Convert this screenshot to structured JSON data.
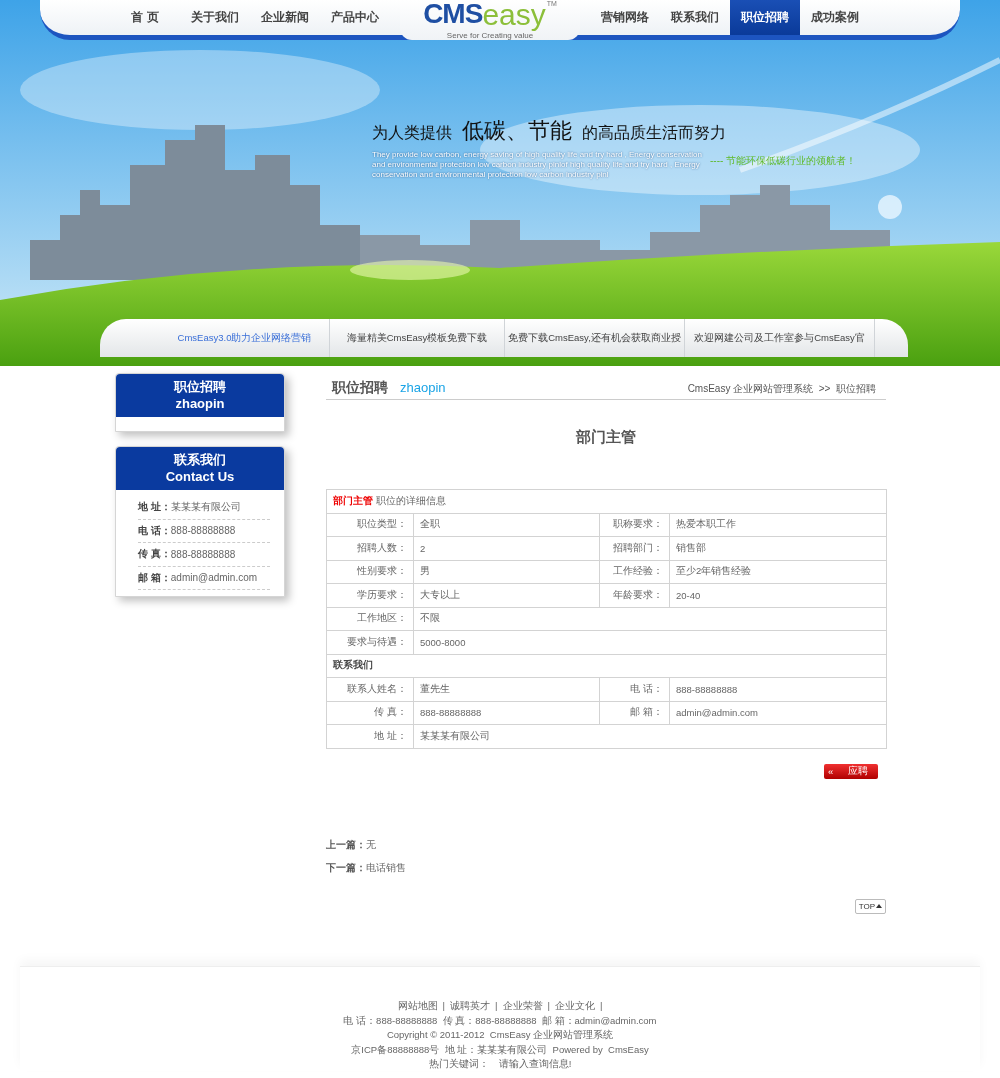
{
  "nav": {
    "left": [
      {
        "label": "首 页",
        "selected": false
      },
      {
        "label": "关于我们",
        "selected": false
      },
      {
        "label": "企业新闻",
        "selected": false
      },
      {
        "label": "产品中心",
        "selected": false
      }
    ],
    "right": [
      {
        "label": "营销网络",
        "selected": false
      },
      {
        "label": "联系我们",
        "selected": false
      },
      {
        "label": "职位招聘",
        "selected": true
      },
      {
        "label": "成功案例",
        "selected": false
      }
    ]
  },
  "logo": {
    "main": "CMS",
    "accent": "easy",
    "trademark": "TM",
    "tagline": "Serve for Creating value"
  },
  "banner": {
    "slogan_start": "为人类提供",
    "slogan_big": "低碳、节能",
    "slogan_end": "的高品质生活而努力",
    "english": "They provide low carbon, energy saving of high quality life and try hard , Energy conservation and environmental protection low carbon industry pinlof high quality life and try hard , Energy conservation and environmental protection low carbon industry pinl",
    "subline": "----  节能环保低碳行业的领航者！"
  },
  "news_tabs": [
    {
      "label": "CmsEasy3.0助力企业网络营销",
      "selected": true
    },
    {
      "label": "海量精美CmsEasy模板免费下载",
      "selected": false
    },
    {
      "label": "免费下载CmsEasy,还有机会获取商业授",
      "selected": false
    },
    {
      "label": "欢迎网建公司及工作室参与CmsEasy官",
      "selected": false
    }
  ],
  "sidebar": {
    "category": {
      "title": "职位招聘",
      "subtitle": "zhaopin"
    },
    "contact": {
      "title": "联系我们",
      "subtitle": "Contact Us",
      "items": [
        {
          "label": "地 址：",
          "value": "某某某有限公司"
        },
        {
          "label": "电 话：",
          "value": "888-88888888"
        },
        {
          "label": "传 真：",
          "value": "888-88888888"
        },
        {
          "label": "邮 箱：",
          "value": "admin@admin.com"
        }
      ]
    }
  },
  "main": {
    "heading": "职位招聘",
    "heading_en": "zhaopin",
    "breadcrumb": "CmsEasy 企业网站管理系统  >>  职位招聘",
    "job_title": "部门主管",
    "table": {
      "caption_highlight": "部门主管",
      "caption": "职位的详细信息",
      "rows": [
        [
          {
            "label": "职位类型：",
            "value": "全职"
          },
          {
            "label": "职称要求：",
            "value": "热爱本职工作"
          }
        ],
        [
          {
            "label": "招聘人数：",
            "value": "2"
          },
          {
            "label": "招聘部门：",
            "value": "销售部"
          }
        ],
        [
          {
            "label": "性别要求：",
            "value": "男"
          },
          {
            "label": "工作经验：",
            "value": "至少2年销售经验"
          }
        ],
        [
          {
            "label": "学历要求：",
            "value": "大专以上"
          },
          {
            "label": "年龄要求：",
            "value": "20-40"
          }
        ],
        [
          {
            "label": "工作地区：",
            "value": "不限"
          }
        ],
        [
          {
            "label": "要求与待遇：",
            "value": "5000-8000"
          }
        ]
      ],
      "contact_heading": "联系我们",
      "contact_rows": [
        [
          {
            "label": "联系人姓名：",
            "value": "董先生"
          },
          {
            "label": "电 话：",
            "value": "888-88888888"
          }
        ],
        [
          {
            "label": "传 真：",
            "value": "888-88888888"
          },
          {
            "label": "邮 箱：",
            "value": "admin@admin.com"
          }
        ],
        [
          {
            "label": "地 址：",
            "value": "某某某有限公司"
          }
        ]
      ]
    },
    "apply_button": {
      "arrow": "«",
      "label": "应聘"
    },
    "prev": {
      "label": "上一篇：",
      "value": "无"
    },
    "next": {
      "label": "下一篇：",
      "value": "电话销售"
    },
    "top_button": "TOP"
  },
  "footer": {
    "links": [
      "网站地图",
      "诚聘英才",
      "企业荣誉",
      "企业文化"
    ],
    "separator": "|",
    "lines": [
      "电 话：888-88888888  传 真：888-88888888  邮 箱：admin@admin.com",
      "Copyright © 2011-2012  CmsEasy 企业网站管理系统",
      "京ICP备88888888号  地 址：某某某有限公司  Powered by  CmsEasy"
    ],
    "keywords_label": "热门关键词：",
    "keywords_value": "请输入查询信息!"
  }
}
